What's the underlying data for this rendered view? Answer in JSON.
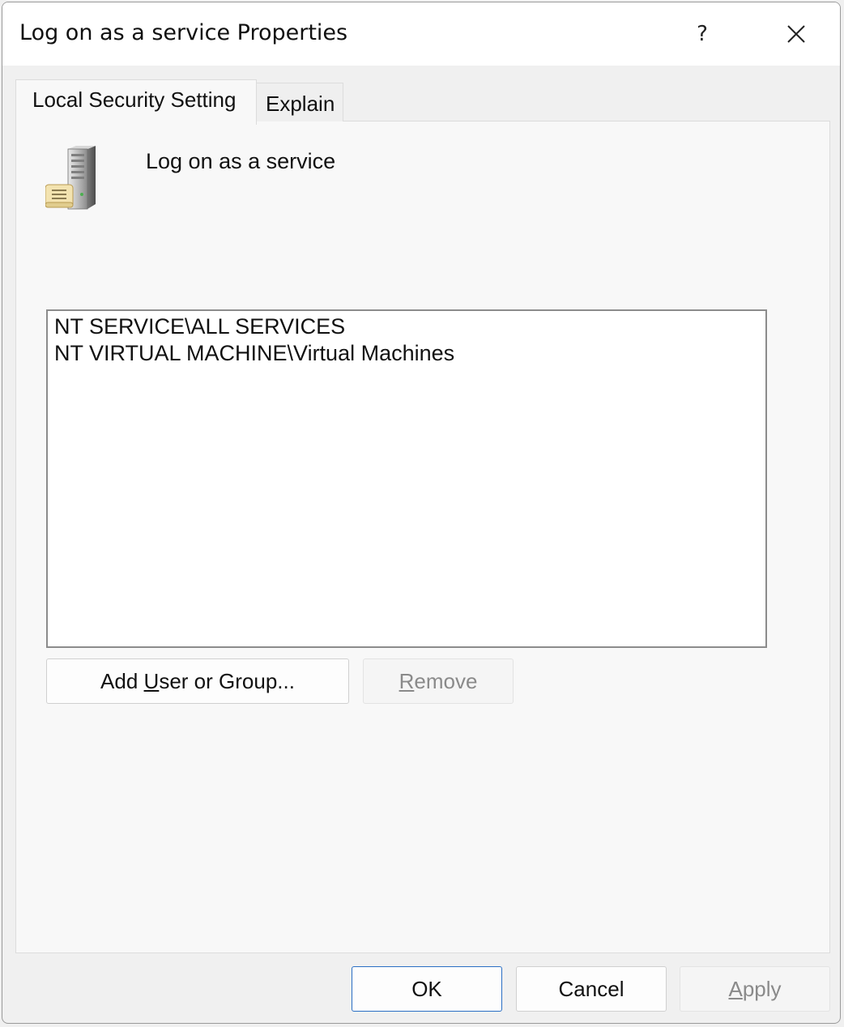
{
  "window": {
    "title": "Log on as a service Properties",
    "help_label": "?",
    "close_icon": "close-icon"
  },
  "tabs": [
    {
      "label": "Local Security Setting",
      "active": true
    },
    {
      "label": "Explain",
      "active": false
    }
  ],
  "policy": {
    "icon": "server-policy-icon",
    "name": "Log on as a service"
  },
  "principals": [
    "NT SERVICE\\ALL SERVICES",
    "NT VIRTUAL MACHINE\\Virtual Machines"
  ],
  "actions": {
    "add": {
      "pre": "Add ",
      "accel": "U",
      "post": "ser or Group...",
      "enabled": true
    },
    "remove": {
      "pre": "",
      "accel": "R",
      "post": "emove",
      "enabled": false
    }
  },
  "footer": {
    "ok": "OK",
    "cancel": "Cancel",
    "apply": {
      "pre": "",
      "accel": "A",
      "post": "pply",
      "enabled": false
    }
  },
  "colors": {
    "title_bar": "#ffffff",
    "panel": "#f8f8f8",
    "default_button_border": "#2a6fc4",
    "disabled_text": "#8a8a8a"
  }
}
